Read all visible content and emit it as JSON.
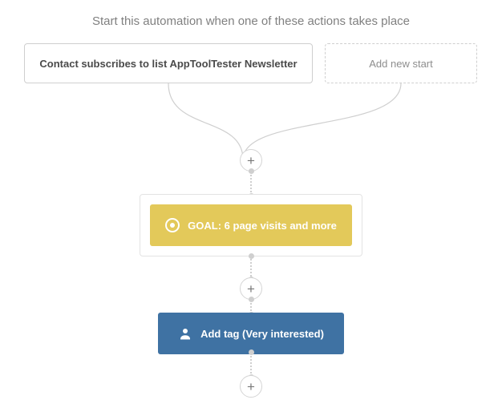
{
  "header": "Start this automation when one of these actions takes place",
  "starts": {
    "trigger": "Contact subscribes to list AppToolTester Newsletter",
    "addNew": "Add new start"
  },
  "goal": {
    "label": "GOAL: 6 page visits and more"
  },
  "action": {
    "label": "Add tag (Very interested)"
  },
  "plus": "+"
}
